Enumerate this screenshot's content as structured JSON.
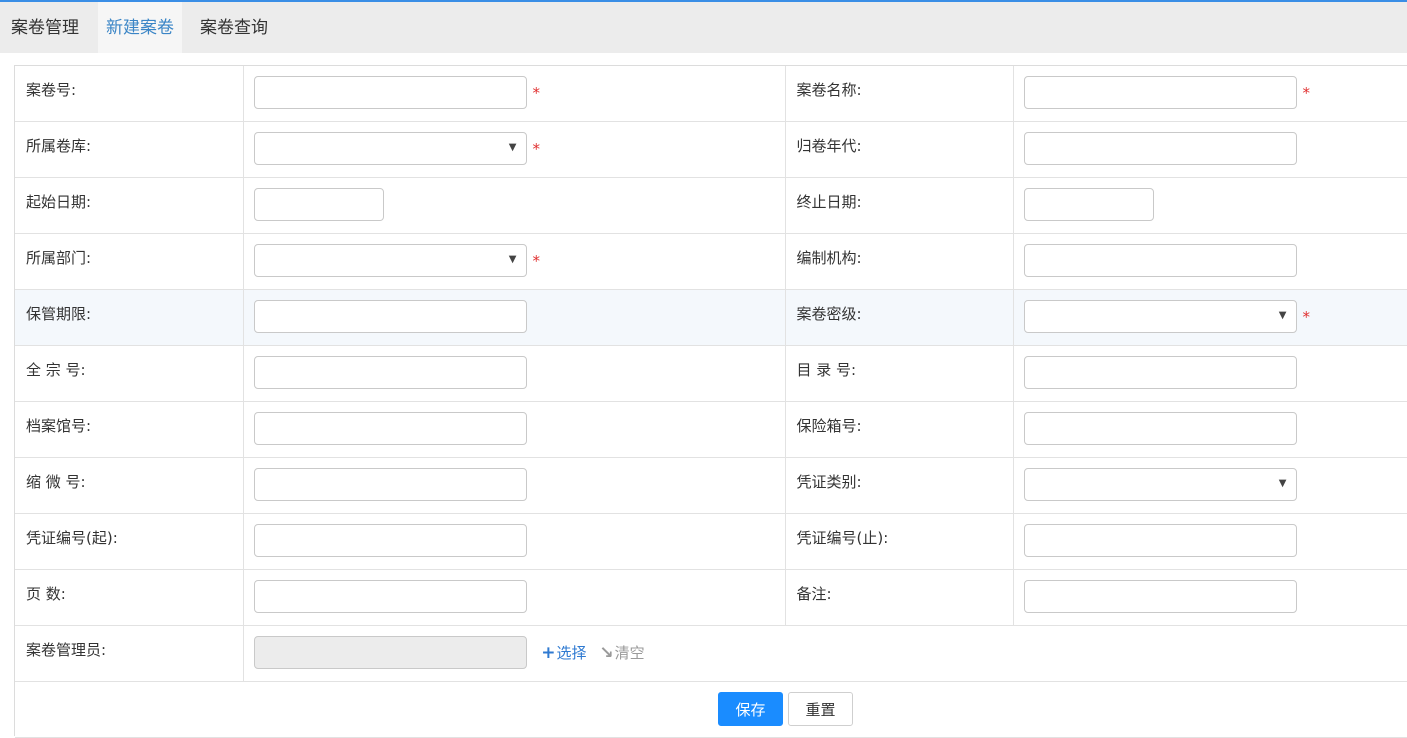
{
  "tabs": [
    "案卷管理",
    "新建案卷",
    "案卷查询"
  ],
  "rows": [
    {
      "left_label": "案卷号:",
      "right_label": "案卷名称:"
    },
    {
      "left_label": "所属卷库:",
      "right_label": "归卷年代:"
    },
    {
      "left_label": "起始日期:",
      "right_label": "终止日期:"
    },
    {
      "left_label": "所属部门:",
      "right_label": "编制机构:"
    },
    {
      "left_label": "保管期限:",
      "right_label": "案卷密级:"
    },
    {
      "left_label": "全 宗 号:",
      "right_label": "目 录 号:"
    },
    {
      "left_label": "档案馆号:",
      "right_label": "保险箱号:"
    },
    {
      "left_label": "缩 微 号:",
      "right_label": "凭证类别:"
    },
    {
      "left_label": "凭证编号(起):",
      "right_label": "凭证编号(止):"
    },
    {
      "left_label": "页 数:",
      "right_label": "备注:"
    }
  ],
  "manager": {
    "label": "案卷管理员:",
    "pick_label": "选择",
    "clear_label": "清空"
  },
  "required_mark": "*",
  "select_arrow": "▼",
  "buttons": {
    "save": "保存",
    "reset": "重置"
  },
  "colors": {
    "accent": "#1a8cff",
    "active_tab": "#3a85c6",
    "required": "#e03030"
  }
}
